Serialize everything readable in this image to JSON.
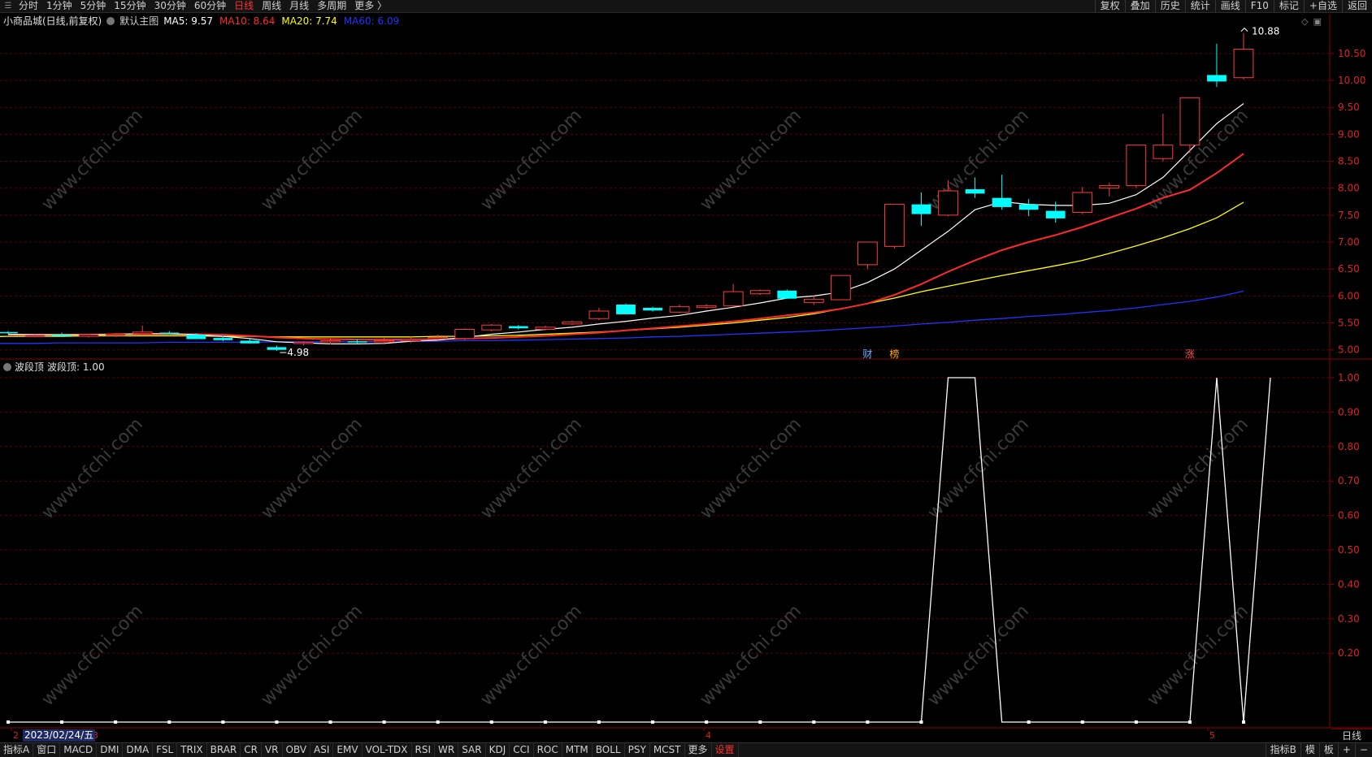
{
  "topbar": {
    "periods": [
      "分时",
      "1分钟",
      "5分钟",
      "15分钟",
      "30分钟",
      "60分钟",
      "日线",
      "周线",
      "月线",
      "多周期",
      "更多 〉"
    ],
    "active_period": "日线",
    "right_tools": [
      "复权",
      "叠加",
      "历史",
      "统计",
      "画线",
      "F10",
      "标记",
      "+自选",
      "返回"
    ]
  },
  "main_chart": {
    "stock_title": "小商品城(日线,前复权)",
    "template": "默认主图",
    "ma": [
      {
        "label": "MA5: 9.57",
        "color": "#ffffff"
      },
      {
        "label": "MA10: 8.64",
        "color": "#ff2a2a"
      },
      {
        "label": "MA20: 7.74",
        "color": "#ffff00"
      },
      {
        "label": "MA60: 6.09",
        "color": "#2233ff"
      }
    ],
    "price_axis": [
      "10.50",
      "10.00",
      "9.50",
      "9.00",
      "8.50",
      "8.00",
      "7.50",
      "7.00",
      "6.50",
      "6.00",
      "5.50",
      "5.00"
    ],
    "high_label": "10.88",
    "low_label": "4.98",
    "event_tags": [
      {
        "text": "财",
        "color": "#6fb0ff"
      },
      {
        "text": "榜",
        "color": "#ffb000"
      },
      {
        "text": "涨",
        "color": "#ff5050"
      }
    ],
    "watermark": "www.cfchi.com"
  },
  "sub_chart": {
    "indicator_name": "波段顶",
    "value_label": "波段顶: 1.00",
    "axis": [
      "1.00",
      "0.90",
      "0.80",
      "0.70",
      "0.60",
      "0.50",
      "0.40",
      "0.30",
      "0.20"
    ]
  },
  "date_axis": {
    "badge": "2023/02/24/五",
    "months": [
      "2",
      "3",
      "4",
      "5"
    ]
  },
  "period_label": "日线",
  "bottombar": {
    "indicators": [
      "指标A",
      "窗口",
      "MACD",
      "DMI",
      "DMA",
      "FSL",
      "TRIX",
      "BRAR",
      "CR",
      "VR",
      "OBV",
      "ASI",
      "EMV",
      "VOL-TDX",
      "RSI",
      "WR",
      "SAR",
      "KDJ",
      "CCI",
      "ROC",
      "MTM",
      "BOLL",
      "PSY",
      "MCST",
      "更多",
      "设置"
    ],
    "active": "设置",
    "right": [
      "指标B",
      "模",
      "板",
      "+",
      "−"
    ]
  },
  "chart_data": [
    {
      "type": "candlestick",
      "title": "小商品城(日线,前复权)",
      "ylim": [
        4.83,
        10.95
      ],
      "candles": [
        [
          5.33,
          5.35,
          5.29,
          5.31
        ],
        [
          5.25,
          5.28,
          5.23,
          5.27
        ],
        [
          5.28,
          5.32,
          5.24,
          5.26
        ],
        [
          5.25,
          5.3,
          5.23,
          5.28
        ],
        [
          5.27,
          5.31,
          5.24,
          5.29
        ],
        [
          5.3,
          5.45,
          5.28,
          5.33
        ],
        [
          5.32,
          5.35,
          5.29,
          5.3
        ],
        [
          5.28,
          5.31,
          5.2,
          5.2
        ],
        [
          5.22,
          5.26,
          5.16,
          5.18
        ],
        [
          5.17,
          5.2,
          5.12,
          5.12
        ],
        [
          5.05,
          5.08,
          4.98,
          5.0
        ],
        [
          5.13,
          5.16,
          5.08,
          5.14
        ],
        [
          5.15,
          5.22,
          5.1,
          5.17
        ],
        [
          5.16,
          5.2,
          5.11,
          5.14
        ],
        [
          5.15,
          5.22,
          5.1,
          5.17
        ],
        [
          5.18,
          5.25,
          5.13,
          5.19
        ],
        [
          5.22,
          5.28,
          5.18,
          5.23
        ],
        [
          5.21,
          5.4,
          5.18,
          5.38
        ],
        [
          5.37,
          5.48,
          5.34,
          5.46
        ],
        [
          5.44,
          5.46,
          5.38,
          5.4
        ],
        [
          5.38,
          5.45,
          5.36,
          5.42
        ],
        [
          5.48,
          5.54,
          5.46,
          5.52
        ],
        [
          5.58,
          5.78,
          5.55,
          5.72
        ],
        [
          5.84,
          5.86,
          5.66,
          5.66
        ],
        [
          5.78,
          5.8,
          5.71,
          5.73
        ],
        [
          5.7,
          5.84,
          5.68,
          5.8
        ],
        [
          5.79,
          5.85,
          5.76,
          5.82
        ],
        [
          5.82,
          6.22,
          5.8,
          6.08
        ],
        [
          6.04,
          6.12,
          6.02,
          6.1
        ],
        [
          6.1,
          6.12,
          5.95,
          5.95
        ],
        [
          5.88,
          6.0,
          5.84,
          5.94
        ],
        [
          5.93,
          6.38,
          5.92,
          6.38
        ],
        [
          6.58,
          7.0,
          6.5,
          7.0
        ],
        [
          6.92,
          7.7,
          6.88,
          7.7
        ],
        [
          7.7,
          7.92,
          7.3,
          7.52
        ],
        [
          7.5,
          8.15,
          7.48,
          7.95
        ],
        [
          7.98,
          8.2,
          7.82,
          7.9
        ],
        [
          7.82,
          8.25,
          7.6,
          7.65
        ],
        [
          7.7,
          7.8,
          7.48,
          7.6
        ],
        [
          7.58,
          7.75,
          7.36,
          7.44
        ],
        [
          7.55,
          8.02,
          7.52,
          7.92
        ],
        [
          8.0,
          8.1,
          7.85,
          8.05
        ],
        [
          8.05,
          8.8,
          8.0,
          8.8
        ],
        [
          8.55,
          9.38,
          8.5,
          8.8
        ],
        [
          8.8,
          9.68,
          8.65,
          9.68
        ],
        [
          10.1,
          10.68,
          9.88,
          9.98
        ],
        [
          10.05,
          10.88,
          10.02,
          10.58
        ]
      ],
      "ma5": [
        5.29,
        5.28,
        5.28,
        5.28,
        5.29,
        5.3,
        5.3,
        5.28,
        5.25,
        5.21,
        5.15,
        5.13,
        5.11,
        5.11,
        5.12,
        5.16,
        5.18,
        5.23,
        5.29,
        5.33,
        5.38,
        5.42,
        5.48,
        5.53,
        5.59,
        5.64,
        5.72,
        5.79,
        5.87,
        5.96,
        6.0,
        6.07,
        6.25,
        6.5,
        6.85,
        7.2,
        7.6,
        7.75,
        7.7,
        7.68,
        7.68,
        7.72,
        7.88,
        8.2,
        8.7,
        9.2,
        9.57
      ],
      "ma10": [
        5.28,
        5.28,
        5.28,
        5.28,
        5.29,
        5.29,
        5.29,
        5.29,
        5.28,
        5.26,
        5.23,
        5.21,
        5.2,
        5.19,
        5.19,
        5.19,
        5.2,
        5.21,
        5.22,
        5.24,
        5.26,
        5.29,
        5.32,
        5.36,
        5.4,
        5.44,
        5.48,
        5.53,
        5.58,
        5.64,
        5.69,
        5.76,
        5.86,
        6.02,
        6.22,
        6.45,
        6.66,
        6.85,
        7.0,
        7.13,
        7.28,
        7.45,
        7.62,
        7.82,
        7.97,
        8.28,
        8.64
      ],
      "ma20": [
        5.24,
        5.24,
        5.25,
        5.25,
        5.25,
        5.26,
        5.26,
        5.26,
        5.26,
        5.26,
        5.25,
        5.25,
        5.24,
        5.24,
        5.24,
        5.24,
        5.24,
        5.24,
        5.25,
        5.25,
        5.26,
        5.27,
        5.29,
        5.31,
        5.33,
        5.36,
        5.39,
        5.42,
        5.46,
        5.5,
        5.55,
        5.6,
        5.67,
        5.76,
        5.86,
        5.96,
        6.08,
        6.18,
        6.28,
        6.38,
        6.47,
        6.56,
        6.66,
        6.79,
        6.93,
        7.08,
        7.25,
        7.45,
        7.74
      ],
      "ma60": [
        5.12,
        5.12,
        5.12,
        5.13,
        5.13,
        5.13,
        5.13,
        5.14,
        5.14,
        5.14,
        5.14,
        5.15,
        5.15,
        5.15,
        5.15,
        5.16,
        5.16,
        5.16,
        5.17,
        5.17,
        5.18,
        5.19,
        5.2,
        5.21,
        5.22,
        5.24,
        5.25,
        5.27,
        5.29,
        5.31,
        5.33,
        5.35,
        5.38,
        5.41,
        5.44,
        5.48,
        5.51,
        5.55,
        5.58,
        5.62,
        5.65,
        5.69,
        5.73,
        5.78,
        5.84,
        5.9,
        5.98,
        6.09
      ]
    },
    {
      "type": "line",
      "title": "波段顶",
      "ylim": [
        0,
        1
      ],
      "values": [
        0,
        0,
        0,
        0,
        0,
        0,
        0,
        0,
        0,
        0,
        0,
        0,
        0,
        0,
        0,
        0,
        0,
        0,
        0,
        0,
        0,
        0,
        0,
        0,
        0,
        0,
        0,
        0,
        0,
        0,
        0,
        0,
        0,
        0,
        0,
        1,
        1,
        0,
        0,
        0,
        0,
        0,
        0,
        0,
        0,
        1,
        0,
        1
      ]
    }
  ]
}
